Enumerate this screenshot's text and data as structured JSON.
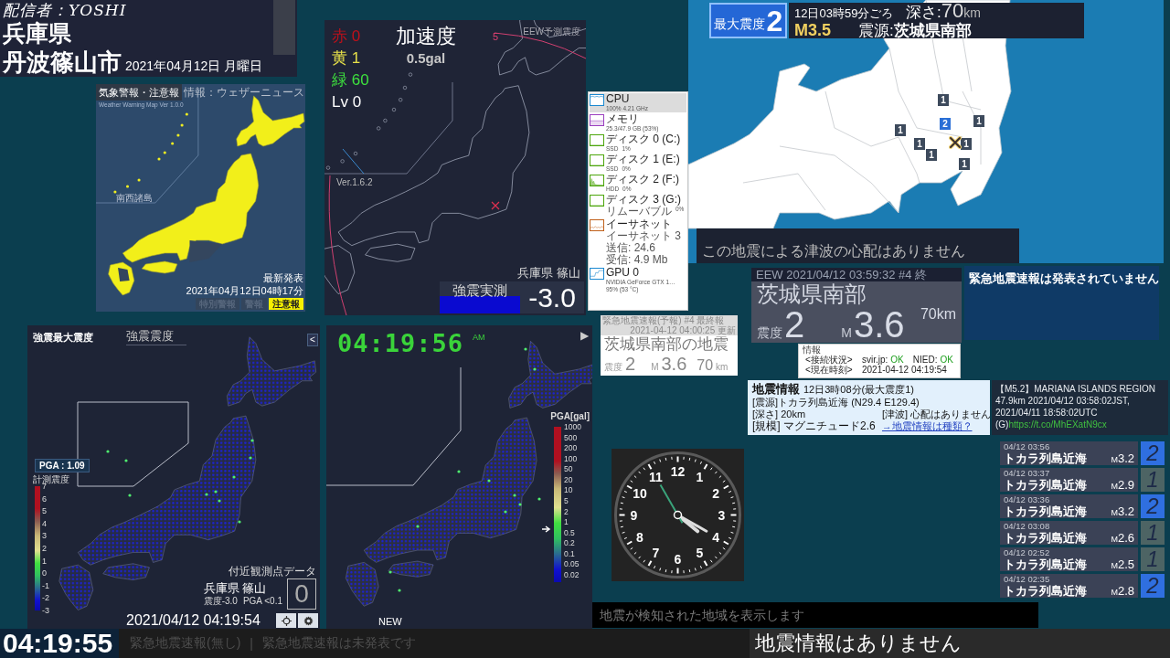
{
  "header": {
    "streamer": "配信者：YOSHI",
    "prefecture": "兵庫県",
    "city": "丹波篠山市",
    "date": "2021年04月12日 月曜日"
  },
  "weather_map": {
    "title": "気象警報・注意報",
    "source": "情報：ウェザーニュース",
    "version": "Weather Warning Map Ver 1.0.0",
    "inset_label": "南西諸島",
    "latest_label": "最新発表",
    "latest_time": "2021年04月12日04時17分",
    "legend": [
      {
        "label": "特別警報",
        "active": false
      },
      {
        "label": "警報",
        "active": false
      },
      {
        "label": "注意報",
        "active": true
      }
    ]
  },
  "acceleration_map": {
    "counts": [
      {
        "label": "赤",
        "value": "0",
        "color": "#c0101a"
      },
      {
        "label": "黄",
        "value": "1",
        "color": "#e6e04a"
      },
      {
        "label": "緑",
        "value": "60",
        "color": "#3ee23e"
      },
      {
        "label": "Lv",
        "value": "0",
        "color": "#ffffff"
      }
    ],
    "title": "加速度",
    "reading": "0.5gal",
    "eew_label": "EEW予測震度",
    "forecast_intensity": "5",
    "version": "Ver.1.6.2",
    "station": "兵庫県 篠山",
    "measured_label": "強震実測",
    "measured_value": "-3.0"
  },
  "resource_monitor": {
    "items": [
      {
        "kind": "full",
        "name": "CPU",
        "details": [
          "100% 4.21 GHz"
        ],
        "color": "#1a88d0",
        "selected": true
      },
      {
        "kind": "band",
        "name": "メモリ",
        "details": [
          "25.3/47.9 GB (53%)"
        ],
        "color": "#9b3fbf",
        "selected": false
      },
      {
        "kind": "flat",
        "name": "ディスク 0 (C:)",
        "details": [
          "SSD",
          "1%"
        ],
        "color": "#4da60c",
        "selected": false
      },
      {
        "kind": "flat",
        "name": "ディスク 1 (E:)",
        "details": [
          "SSD",
          "0%"
        ],
        "color": "#4da60c",
        "selected": false
      },
      {
        "kind": "spike",
        "name": "ディスク 2 (F:)",
        "details": [
          "HDD",
          "0%"
        ],
        "color": "#4da60c",
        "selected": false
      },
      {
        "kind": "flat",
        "name": "ディスク 3 (G:)",
        "details": [
          "リムーバブル",
          "0%"
        ],
        "color": "#4da60c",
        "selected": false
      },
      {
        "kind": "noise",
        "name": "イーサネット",
        "details": [
          "イーサネット 3",
          "送信: 24.6",
          "受信: 4.9 Mb"
        ],
        "color": "#c0601a",
        "selected": false
      },
      {
        "kind": "step",
        "name": "GPU 0",
        "details": [
          "NVIDIA GeForce GTX 1…",
          "95% (53 °C)"
        ],
        "color": "#1a88d0",
        "selected": false
      }
    ]
  },
  "quake_map": {
    "badge_label": "最大震度",
    "badge_value": "2",
    "time": "12日03時59分ごろ",
    "magnitude": "M3.5",
    "depth_label": "深さ:",
    "depth_value": "70",
    "depth_unit": "km",
    "epicenter_label": "震源:",
    "epicenter": "茨城県南部",
    "markers": [
      {
        "label": "1",
        "color": "#3d4a5c"
      },
      {
        "label": "1",
        "color": "#3d4a5c"
      },
      {
        "label": "2",
        "color": "#2a6fd6"
      },
      {
        "label": "1",
        "color": "#3d4a5c"
      },
      {
        "label": "1",
        "color": "#3d4a5c"
      },
      {
        "label": "1",
        "color": "#3d4a5c"
      },
      {
        "label": "1",
        "color": "#3d4a5c"
      },
      {
        "label": "1",
        "color": "#3d4a5c"
      }
    ],
    "tsunami": "この地震による津波の心配はありません"
  },
  "eew_panel": {
    "header": "EEW 2021/04/12 03:59:32 #4 終",
    "region": "茨城県南部",
    "intensity_label": "震度",
    "intensity": "2",
    "magnitude_label": "M",
    "magnitude": "3.6",
    "depth": "70km"
  },
  "eew_status": {
    "message": "緊急地震速報は発表されていません"
  },
  "eew_forecast": {
    "title": "緊急地震速報(予報) #4 最終報",
    "updated": "2021-04-12 04:00:25 更新",
    "headline": "茨城県南部の地震",
    "intensity_label": "震度",
    "intensity": "2",
    "magnitude_label": "M",
    "magnitude": "3.6",
    "depth": "70",
    "depth_unit": "km"
  },
  "info_box": {
    "legend": "情報",
    "connection_label": "<接続状況>",
    "servers": [
      {
        "name": "svir.jp:",
        "status": "OK",
        "ok": true
      },
      {
        "name": "NIED:",
        "status": "OK",
        "ok": true
      }
    ],
    "time_label": "<現在時刻>",
    "time": "2021-04-12 04:19:54"
  },
  "quake_info": {
    "title": "地震情報",
    "subtitle": "12日3時08分(最大震度1)",
    "epicenter": "[震源]トカラ列島近海 (N29.4 E129.4)",
    "depth": "[深さ] 20km",
    "tsunami": "[津波] 心配はありません",
    "scale": "[規模] マグニチュード2.6",
    "link": "→地震情報は種類？"
  },
  "overseas_quake": {
    "headline": "【M5.2】MARIANA ISLANDS REGION",
    "detail": "47.9km 2021/04/12 03:58:02JST,",
    "utc": "2021/04/11 18:58:02UTC",
    "source": "(G)",
    "link": "https://t.co/MhEXatN9cx"
  },
  "clock": {
    "numerals": [
      "11",
      "12",
      "1",
      "10",
      "2",
      "9",
      "3",
      "8",
      "4",
      "7",
      "5",
      "6"
    ]
  },
  "recent_quakes": [
    {
      "time": "04/12 03:56",
      "place": "トカラ列島近海",
      "magnitude_prefix": "M",
      "magnitude": "3.2",
      "intensity": "2",
      "color": "#2f6fe0"
    },
    {
      "time": "04/12 03:37",
      "place": "トカラ列島近海",
      "magnitude_prefix": "M",
      "magnitude": "2.9",
      "intensity": "1",
      "color": "#4d6464"
    },
    {
      "time": "04/12 03:36",
      "place": "トカラ列島近海",
      "magnitude_prefix": "M",
      "magnitude": "3.2",
      "intensity": "2",
      "color": "#2f6fe0"
    },
    {
      "time": "04/12 03:08",
      "place": "トカラ列島近海",
      "magnitude_prefix": "M",
      "magnitude": "2.6",
      "intensity": "1",
      "color": "#4d6464"
    },
    {
      "time": "04/12 02:52",
      "place": "トカラ列島近海",
      "magnitude_prefix": "M",
      "magnitude": "2.5",
      "intensity": "1",
      "color": "#4d6464"
    },
    {
      "time": "04/12 02:35",
      "place": "トカラ列島近海",
      "magnitude_prefix": "M",
      "magnitude": "2.8",
      "intensity": "2",
      "color": "#2f6fe0"
    }
  ],
  "detection_bar": {
    "message": "地震が検知された地域を表示します"
  },
  "intensity_map": {
    "title": "強震最大震度",
    "layer": "強震震度",
    "collapse": "<",
    "pga": "PGA : 1.09",
    "scale_label": "計測震度",
    "scale_ticks": [
      "7",
      "6",
      "5",
      "4",
      "3",
      "2",
      "1",
      "0",
      "-1",
      "-2",
      "-3"
    ],
    "nearby_label": "付近観測点データ",
    "station": "兵庫県 篠山",
    "station_intensity": "震度-3.0",
    "station_pga": "PGA <0.1",
    "station_value": "0",
    "timestamp": "2021/04/12 04:19:54"
  },
  "pga_map": {
    "clock": "04:19:56",
    "meridiem": "AM",
    "play": "▶",
    "scale_label": "PGA[gal]",
    "scale_ticks": [
      "1000",
      "500",
      "200",
      "100",
      "50",
      "20",
      "10",
      "5",
      "2",
      "1",
      "0.5",
      "0.2",
      "0.1",
      "0.05",
      "0.02"
    ],
    "level": 0.34,
    "new_label": "NEW"
  },
  "status_bar": {
    "time": "04:19:55",
    "eew": "緊急地震速報(無し)",
    "separator": "|",
    "eew_status": "緊急地震速報は未発表です",
    "quake_info": "地震情報はありません"
  }
}
